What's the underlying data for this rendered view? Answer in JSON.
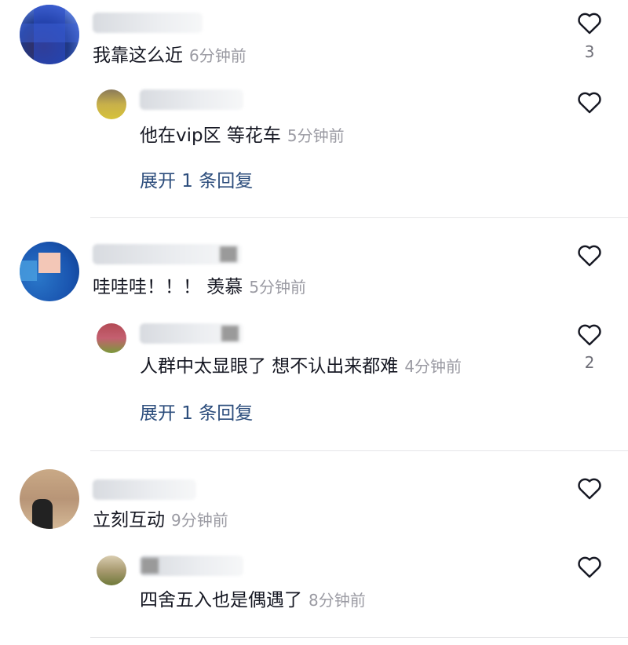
{
  "comments": [
    {
      "text": "我靠这么近",
      "time": "6分钟前",
      "likes": "3",
      "reply": {
        "text": "他在vip区 等花车",
        "time": "5分钟前"
      },
      "expand": "展开 1 条回复"
    },
    {
      "text": "哇哇哇！！！ 羡慕",
      "time": "5分钟前",
      "likes": "",
      "reply": {
        "text": "人群中太显眼了 想不认出来都难",
        "time": "4分钟前",
        "likes": "2"
      },
      "expand": "展开 1 条回复"
    },
    {
      "text": "立刻互动",
      "time": "9分钟前",
      "likes": "",
      "reply": {
        "text": "四舍五入也是偶遇了",
        "time": "8分钟前"
      }
    }
  ],
  "colors": {
    "link": "#2c4d7c",
    "meta": "#9b9ba3",
    "divider": "#e6e6e8"
  },
  "icons": {
    "like": "heart-outline-icon"
  }
}
